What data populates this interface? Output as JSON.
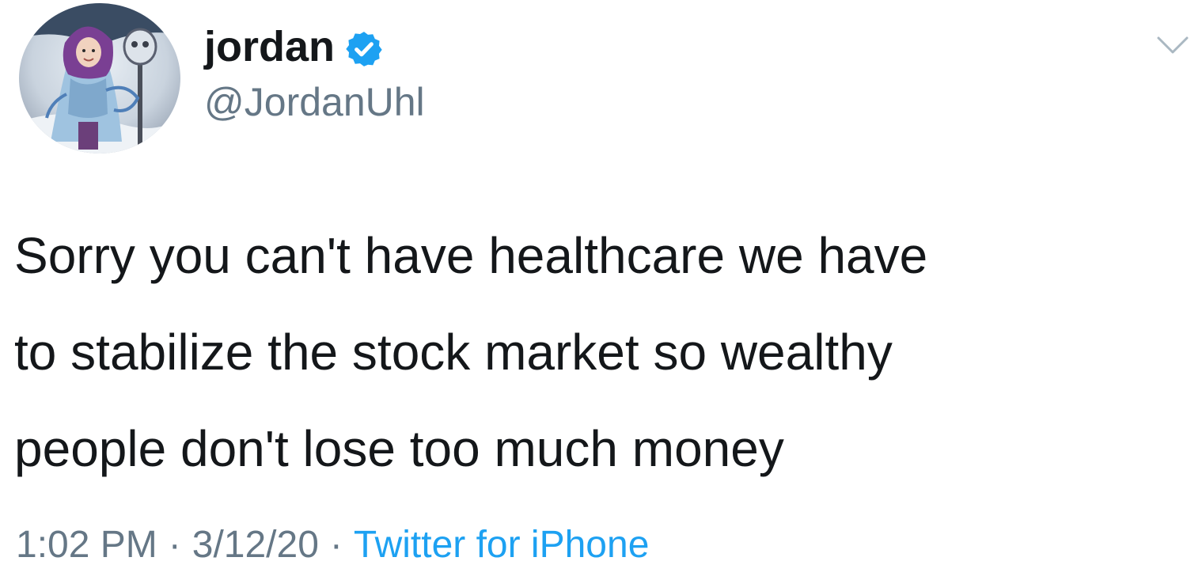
{
  "user": {
    "display_name": "jordan",
    "handle": "@JordanUhl",
    "verified": true,
    "avatar_icon": "profile-avatar"
  },
  "tweet": {
    "text": "Sorry you can't have healthcare we have\nto stabilize the stock market so wealthy\npeople don't lose too much money",
    "time": "1:02 PM",
    "separator": "·",
    "date": "3/12/20",
    "source": "Twitter for iPhone"
  },
  "menu": {
    "icon": "chevron-down-icon"
  },
  "colors": {
    "text": "#14171a",
    "secondary": "#657786",
    "link": "#1da1f2",
    "verified_badge": "#1da1f2"
  }
}
